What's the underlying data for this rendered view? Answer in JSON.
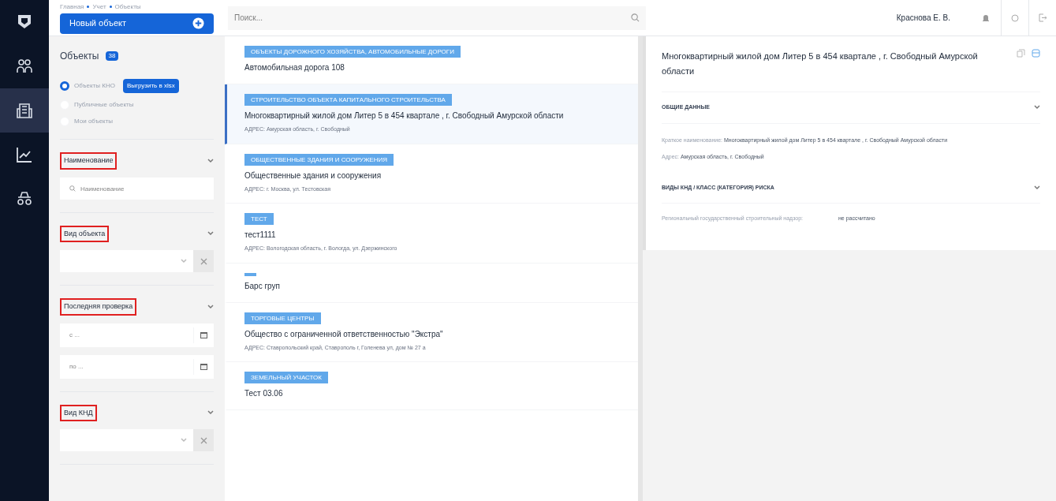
{
  "nav": [
    {
      "kind": "logo",
      "selected": false
    },
    {
      "kind": "people",
      "selected": false
    },
    {
      "kind": "building",
      "selected": true
    },
    {
      "kind": "chart",
      "selected": false
    },
    {
      "kind": "spy",
      "selected": false
    }
  ],
  "breadcrumbs": [
    "Главная",
    "Учет",
    "Объекты"
  ],
  "new_button": "Новый объект",
  "search": {
    "placeholder": "Поиск..."
  },
  "user": "Краснова Е. В.",
  "panel": {
    "title": "Объекты",
    "count": "38",
    "export_button": "Выгрузить в xlsx",
    "radios": [
      {
        "label": "Объекты КНО",
        "selected": true
      },
      {
        "label": "Публичные объекты",
        "selected": false
      },
      {
        "label": "Мои объекты",
        "selected": false
      }
    ],
    "filters": [
      {
        "kind": "search",
        "label": "Наименование",
        "highlighted": true,
        "placeholder": "Наименование"
      },
      {
        "kind": "select",
        "label": "Вид объекта",
        "highlighted": true
      },
      {
        "kind": "dates",
        "label": "Последняя проверка",
        "highlighted": true,
        "placeholder_from": "с ...",
        "placeholder_to": "по ..."
      },
      {
        "kind": "select",
        "label": "Вид КНД",
        "highlighted": true
      }
    ]
  },
  "list": [
    {
      "tag": "ОБЪЕКТЫ ДОРОЖНОГО ХОЗЯЙСТВА, АВТОМОБИЛЬНЫЕ ДОРОГИ",
      "title": "Автомобильная дорога 108",
      "selected": false
    },
    {
      "tag": "СТРОИТЕЛЬСТВО ОБЪЕКТА КАПИТАЛЬНОГО СТРОИТЕЛЬСТВА",
      "title": "Многоквартирный жилой дом Литер 5 в 454 квартале , г. Свободный Амурской области",
      "address": "АДРЕС: Амурская область, г. Свободный",
      "selected": true
    },
    {
      "tag": "ОБЩЕСТВЕННЫЕ ЗДАНИЯ И СООРУЖЕНИЯ",
      "title": "Общественные здания и сооружения",
      "address": "АДРЕС: г. Москва, ул. Тестовская",
      "selected": false
    },
    {
      "tag": "ТЕСТ",
      "title": "тест1111",
      "address": "АДРЕС: Вологодская область, г. Вологда, ул. Дзержинского",
      "selected": false
    },
    {
      "empty_tag": true,
      "title": "Барс груп",
      "selected": false
    },
    {
      "tag": "ТОРГОВЫЕ ЦЕНТРЫ",
      "title": "Общество с ограниченной ответственностью \"Экстра\"",
      "address": "АДРЕС: Ставропольский край, Ставрополь г, Голенева ул, дом № 27 а",
      "selected": false
    },
    {
      "tag": "ЗЕМЕЛЬНЫЙ УЧАСТОК",
      "title": "Тест 03.06",
      "selected": false
    }
  ],
  "detail": {
    "title": "Многоквартирный жилой дом Литер 5 в 454 квартале , г. Свободный Амурской области",
    "sections": [
      {
        "title": "ОБЩИЕ ДАННЫЕ",
        "fields": [
          {
            "label": "Краткое наименование:",
            "value": "Многоквартирный жилой дом Литер 5 в 454 квартале , г. Свободный Амурской области"
          },
          {
            "label": "Адрес:",
            "value": "Амурская область, г. Свободный"
          }
        ]
      },
      {
        "title": "ВИДЫ КНД / КЛАСС (КАТЕГОРИЯ) РИСКА",
        "rows": [
          {
            "label": "Региональный государственный строительный надзор:",
            "value": "не рассчитано"
          }
        ]
      }
    ]
  }
}
